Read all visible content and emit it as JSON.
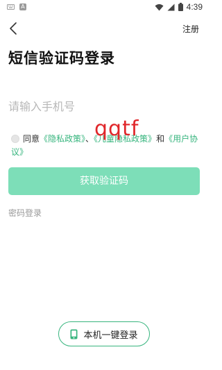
{
  "status_bar": {
    "time": "4:39",
    "left_icons": [
      "keyboard-icon",
      "a-icon"
    ],
    "right_icons": [
      "wifi-icon",
      "cellular-icon",
      "battery-icon"
    ],
    "a_glyph": "A"
  },
  "header": {
    "back_icon": "back-chevron-icon",
    "register_label": "注册"
  },
  "title": "短信验证码登录",
  "phone_input": {
    "placeholder": "请输入手机号",
    "value": ""
  },
  "agreement": {
    "checked": false,
    "prefix": "同意",
    "privacy_policy": "《隐私政策》",
    "children_policy": "《儿童隐私政策》",
    "and": "和",
    "user_agreement": "《用户协议》"
  },
  "watermark": "qqtf",
  "get_code_label": "获取验证码",
  "password_login_label": "密码登录",
  "one_click_login": {
    "icon": "phone-icon",
    "label": "本机一键登录"
  },
  "colors": {
    "accent": "#37b57e",
    "button_disabled": "#7ddeb8",
    "watermark": "#e0262a",
    "placeholder": "#b8b8b8"
  }
}
